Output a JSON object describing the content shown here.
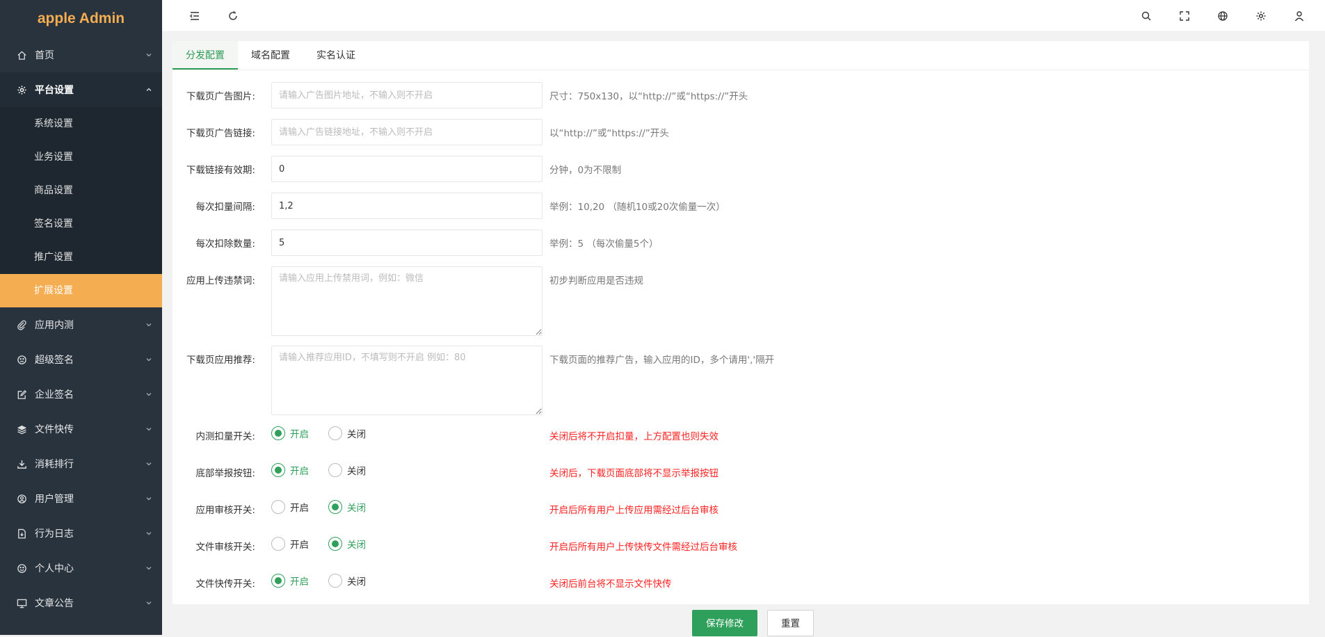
{
  "app": {
    "logo": "apple Admin"
  },
  "sidebar": {
    "items": [
      {
        "label": "首页",
        "icon": "home-icon"
      },
      {
        "label": "平台设置",
        "icon": "gear-icon",
        "children": [
          "系统设置",
          "业务设置",
          "商品设置",
          "签名设置",
          "推广设置",
          "扩展设置"
        ],
        "active_child": "扩展设置"
      },
      {
        "label": "应用内测",
        "icon": "paperclip-icon"
      },
      {
        "label": "超级签名",
        "icon": "face-icon"
      },
      {
        "label": "企业签名",
        "icon": "edit-icon"
      },
      {
        "label": "文件快传",
        "icon": "layers-icon"
      },
      {
        "label": "消耗排行",
        "icon": "download-icon"
      },
      {
        "label": "用户管理",
        "icon": "user-circle-icon"
      },
      {
        "label": "行为日志",
        "icon": "file-icon"
      },
      {
        "label": "个人中心",
        "icon": "smile-icon"
      },
      {
        "label": "文章公告",
        "icon": "monitor-icon"
      }
    ]
  },
  "header": {
    "icons": [
      "menu-fold-icon",
      "refresh-icon",
      "search-icon",
      "fullscreen-icon",
      "globe-icon",
      "settings-icon",
      "user-icon"
    ]
  },
  "tabs": [
    {
      "label": "分发配置",
      "active": true
    },
    {
      "label": "域名配置",
      "active": false
    },
    {
      "label": "实名认证",
      "active": false
    }
  ],
  "form": {
    "ad_image": {
      "label": "下载页广告图片:",
      "value": "",
      "placeholder": "请输入广告图片地址，不输入则不开启",
      "hint": "尺寸：750x130，以“http://”或“https://”开头"
    },
    "ad_link": {
      "label": "下载页广告链接:",
      "value": "",
      "placeholder": "请输入广告链接地址，不输入则不开启",
      "hint": "以“http://”或“https://”开头"
    },
    "link_expire": {
      "label": "下载链接有效期:",
      "value": "0",
      "placeholder": "",
      "hint": "分钟，0为不限制"
    },
    "deduct_interval": {
      "label": "每次扣量间隔:",
      "value": "1,2",
      "placeholder": "",
      "hint": "举例：10,20 （随机10或20次偷量一次）"
    },
    "deduct_count": {
      "label": "每次扣除数量:",
      "value": "5",
      "placeholder": "",
      "hint": "举例：5 （每次偷量5个）"
    },
    "banned_words": {
      "label": "应用上传违禁词:",
      "value": "",
      "placeholder": "请输入应用上传禁用词，例如：微信",
      "hint": "初步判断应用是否违规"
    },
    "recommend": {
      "label": "下载页应用推荐:",
      "value": "",
      "placeholder": "请输入推荐应用ID，不填写则不开启 例如：80",
      "hint": "下载页面的推荐广告，输入应用的ID，多个请用','隔开"
    },
    "switches": [
      {
        "label": "内测扣量开关:",
        "value": "开启",
        "hint": "关闭后将不开启扣量，上方配置也则失效"
      },
      {
        "label": "底部举报按钮:",
        "value": "开启",
        "hint": "关闭后，下载页面底部将不显示举报按钮"
      },
      {
        "label": "应用审核开关:",
        "value": "关闭",
        "hint": "开启后所有用户上传应用需经过后台审核"
      },
      {
        "label": "文件审核开关:",
        "value": "关闭",
        "hint": "开启后所有用户上传快传文件需经过后台审核"
      },
      {
        "label": "文件快传开关:",
        "value": "开启",
        "hint": "关闭后前台将不显示文件快传"
      }
    ],
    "option_on": "开启",
    "option_off": "关闭"
  },
  "buttons": {
    "save": "保存修改",
    "reset": "重置"
  },
  "colors": {
    "accent": "#2fa05b",
    "sidebar_bg": "#28333e",
    "active_menu": "#f5ad52",
    "warning": "#ff2222"
  }
}
